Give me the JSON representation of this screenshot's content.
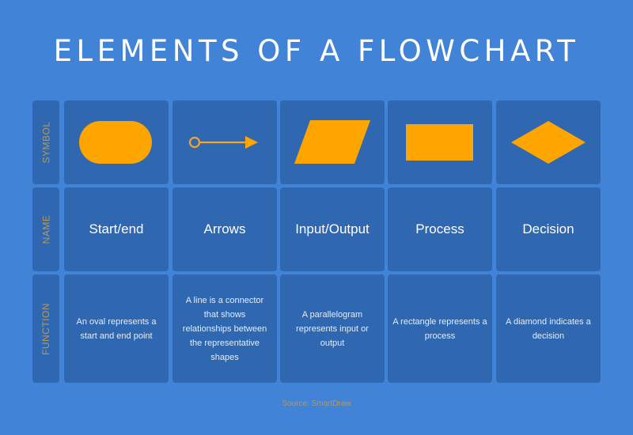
{
  "title": "ELEMENTS OF A FLOWCHART",
  "row_labels": [
    "SYMBOL",
    "NAME",
    "FUNCTION"
  ],
  "colors": {
    "background": "#4183d7",
    "cell": "#2f67b0",
    "shape_fill": "#ffa500",
    "label_text": "#b59a5e",
    "text": "#ffffff"
  },
  "elements": [
    {
      "symbol": "oval-icon",
      "name": "Start/end",
      "function": "An oval represents a start and end point"
    },
    {
      "symbol": "arrow-icon",
      "name": "Arrows",
      "function": "A line is a connector that shows relationships between the representative shapes"
    },
    {
      "symbol": "parallelogram-icon",
      "name": "Input/Output",
      "function": "A parallelogram represents input or output"
    },
    {
      "symbol": "rectangle-icon",
      "name": "Process",
      "function": "A rectangle represents a process"
    },
    {
      "symbol": "diamond-icon",
      "name": "Decision",
      "function": "A diamond indicates a decision"
    }
  ],
  "source": "Source: SmartDraw"
}
